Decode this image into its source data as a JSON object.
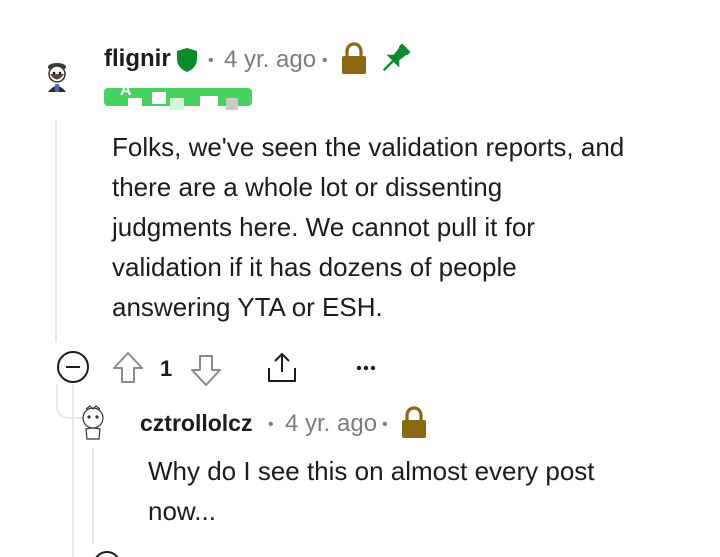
{
  "comments": [
    {
      "username": "flignir",
      "time": "4 yr. ago",
      "flair": "A",
      "body_lines": [
        "Folks, we've seen the validation reports, and",
        "there are a whole lot or dissenting",
        "judgments here. We cannot pull it for",
        "validation if it has dozens of people",
        "answering YTA or ESH."
      ],
      "score": "1"
    },
    {
      "username": "cztrollolcz",
      "time": "4 yr. ago",
      "body_lines": [
        "Why do I see this on almost every post",
        "now..."
      ]
    }
  ],
  "separator": "•",
  "colors": {
    "mod_green": "#0a8a28",
    "lock_gold": "#8b6914",
    "flair_green": "#46d160",
    "thread_line": "#e6e8ea"
  },
  "icons": [
    "avatar",
    "mod-shield-icon",
    "lock-icon",
    "pin-icon",
    "collapse-icon",
    "upvote-icon",
    "downvote-icon",
    "share-icon",
    "more-icon"
  ]
}
